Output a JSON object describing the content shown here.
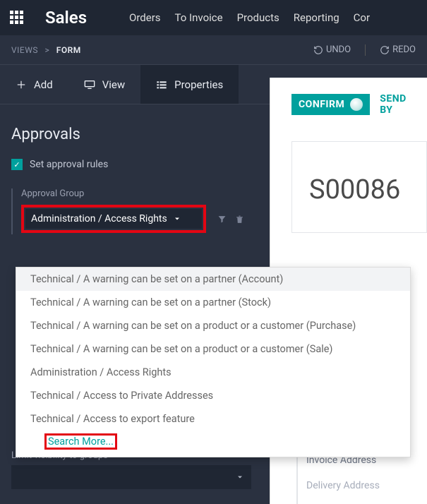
{
  "topbar": {
    "brand": "Sales",
    "nav": [
      "Orders",
      "To Invoice",
      "Products",
      "Reporting",
      "Cor"
    ]
  },
  "breadcrumb": {
    "root": "VIEWS",
    "sep": ">",
    "current": "FORM"
  },
  "undo": "UNDO",
  "redo": "REDO",
  "tabs": {
    "add": "Add",
    "view": "View",
    "properties": "Properties"
  },
  "panel": {
    "title": "Approvals",
    "set_rules": "Set approval rules",
    "approval_group_label": "Approval Group",
    "approval_group_value": "Administration / Access Rights",
    "limit_label": "Limit visibility to groups"
  },
  "dropdown": {
    "items": [
      "Technical / A warning can be set on a partner (Account)",
      "Technical / A warning can be set on a partner (Stock)",
      "Technical / A warning can be set on a product or a customer (Purchase)",
      "Technical / A warning can be set on a product or a customer (Sale)",
      "Administration / Access Rights",
      "Technical / Access to Private Addresses",
      "Technical / Access to export feature"
    ],
    "search_more": "Search More..."
  },
  "card": {
    "confirm": "CONFIRM",
    "send_by": "SEND BY",
    "doc": "S00086",
    "invoice_address": "Invoice Address",
    "delivery_address": "Delivery Address"
  }
}
